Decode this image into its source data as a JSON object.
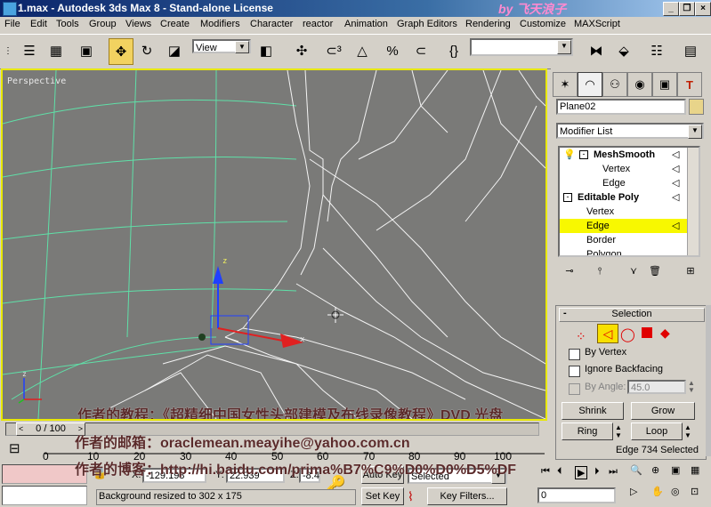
{
  "window": {
    "title": "1.max - Autodesk 3ds Max 8  - Stand-alone License",
    "watermark": "by 飞天浪子"
  },
  "menus": [
    "File",
    "Edit",
    "Tools",
    "Group",
    "Views",
    "Create",
    "Modifiers",
    "Character",
    "reactor",
    "Animation",
    "Graph Editors",
    "Rendering",
    "Customize",
    "MAXScript"
  ],
  "toolbar": {
    "view_combo": "View",
    "selection_set_placeholder": ""
  },
  "viewport": {
    "label": "Perspective",
    "axis_x": "x",
    "axis_z": "z"
  },
  "command_panel": {
    "object_name": "Plane02",
    "modifier_list": "Modifier List",
    "stack": [
      {
        "label": "MeshSmooth",
        "bold": true
      },
      {
        "label": "Vertex",
        "bold": false
      },
      {
        "label": "Edge",
        "bold": false
      },
      {
        "label": "Editable Poly",
        "bold": true
      },
      {
        "label": "Vertex",
        "bold": false
      },
      {
        "label": "Edge",
        "bold": false,
        "selected": true
      },
      {
        "label": "Border",
        "bold": false
      },
      {
        "label": "Polygon",
        "bold": false
      }
    ],
    "selection": {
      "title": "Selection",
      "by_vertex": "By Vertex",
      "ignore_backfacing": "Ignore Backfacing",
      "by_angle": "By Angle:",
      "by_angle_value": "45.0",
      "shrink": "Shrink",
      "grow": "Grow",
      "ring": "Ring",
      "loop": "Loop",
      "status": "Edge 734 Selected"
    }
  },
  "time": {
    "slider": "0 / 100",
    "ticks": [
      "0",
      "10",
      "20",
      "30",
      "40",
      "50",
      "60",
      "70",
      "80",
      "90",
      "100"
    ]
  },
  "status": {
    "x_label": "X:",
    "x_value": "-129.198",
    "y_label": "Y:",
    "y_value": "22.939",
    "z_label": "Z:",
    "z_value": "-8.4",
    "prompt": "Background resized to 302 x 175",
    "auto_key": "Auto Key",
    "set_key": "Set Key",
    "selected": "Selected",
    "key_filters": "Key Filters...",
    "frame": "0"
  },
  "overlay_text": [
    "作者的教程：《超精细中国女性头部建模及布线录像教程》DVD 光盘",
    "作者的邮箱：oraclemean.meayihe@yahoo.com.cn",
    "作者的博客：http://hi.baidu.com/prima%B7%C9%D0%D0%D5%DF"
  ]
}
